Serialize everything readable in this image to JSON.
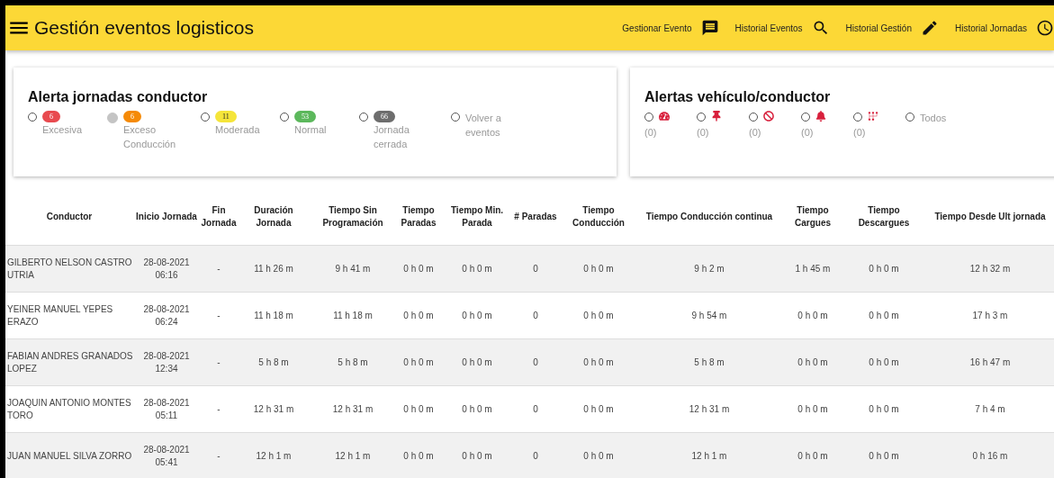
{
  "header": {
    "title": "Gestión eventos logisticos",
    "nav": [
      {
        "label": "Gestionar Evento"
      },
      {
        "label": "Historial Eventos"
      },
      {
        "label": "Historial Gestión"
      },
      {
        "label": "Historial Jornadas"
      }
    ]
  },
  "shift_alerts": {
    "title": "Alerta jornadas conductor",
    "items": [
      {
        "label": "Excesiva",
        "count": "6",
        "color": "#e84a4f",
        "disabled": false
      },
      {
        "label": "Exceso Conducción",
        "count": "6",
        "color": "#f58a07",
        "disabled": true
      },
      {
        "label": "Moderada",
        "count": "11",
        "color": "#f5e53a",
        "disabled": false
      },
      {
        "label": "Normal",
        "count": "53",
        "color": "#5cb85c",
        "disabled": false
      },
      {
        "label": "Jornada cerrada",
        "count": "66",
        "color": "#6d6d6d",
        "disabled": false
      },
      {
        "label": "Volver a eventos",
        "disabled": false
      }
    ]
  },
  "vehicle_alerts": {
    "title": "Alertas vehículo/conductor",
    "items": [
      {
        "count": "(0)",
        "selected": false
      },
      {
        "count": "(0)",
        "selected": false
      },
      {
        "count": "(0)",
        "selected": false
      },
      {
        "count": "(0)",
        "selected": false
      },
      {
        "count": "(0)",
        "selected": false
      },
      {
        "label": "Todos",
        "selected": false
      }
    ]
  },
  "table": {
    "columns": [
      "Conductor",
      "Inicio Jornada",
      "Fin Jornada",
      "Duración Jornada",
      "Tiempo Sin Programación",
      "Tiempo Paradas",
      "Tiempo Min. Parada",
      "# Paradas",
      "Tiempo Conducción",
      "Tiempo Conducción continua",
      "Tiempo Cargues",
      "Tiempo Descargues",
      "Tiempo Desde Ult jornada"
    ],
    "rows": [
      [
        "GILBERTO NELSON CASTRO UTRIA",
        "28-08-2021 06:16",
        "-",
        "11 h 26 m",
        "9 h 41 m",
        "0 h 0 m",
        "0 h 0 m",
        "0",
        "0 h 0 m",
        "9 h 2 m",
        "1 h 45 m",
        "0 h 0 m",
        "12 h 32 m"
      ],
      [
        "YEINER MANUEL YEPES ERAZO",
        "28-08-2021 06:24",
        "-",
        "11 h 18 m",
        "11 h 18 m",
        "0 h 0 m",
        "0 h 0 m",
        "0",
        "0 h 0 m",
        "9 h 54 m",
        "0 h 0 m",
        "0 h 0 m",
        "17 h 3 m"
      ],
      [
        "FABIAN ANDRES GRANADOS LOPEZ",
        "28-08-2021 12:34",
        "-",
        "5 h 8 m",
        "5 h 8 m",
        "0 h 0 m",
        "0 h 0 m",
        "0",
        "0 h 0 m",
        "5 h 8 m",
        "0 h 0 m",
        "0 h 0 m",
        "16 h 47 m"
      ],
      [
        "JOAQUIN ANTONIO MONTES TORO",
        "28-08-2021 05:11",
        "-",
        "12 h 31 m",
        "12 h 31 m",
        "0 h 0 m",
        "0 h 0 m",
        "0",
        "0 h 0 m",
        "12 h 31 m",
        "0 h 0 m",
        "0 h 0 m",
        "7 h 4 m"
      ],
      [
        "JUAN MANUEL SILVA ZORRO",
        "28-08-2021 05:41",
        "-",
        "12 h 1 m",
        "12 h 1 m",
        "0 h 0 m",
        "0 h 0 m",
        "0",
        "0 h 0 m",
        "12 h 1 m",
        "0 h 0 m",
        "0 h 0 m",
        "0 h 16 m"
      ]
    ]
  }
}
